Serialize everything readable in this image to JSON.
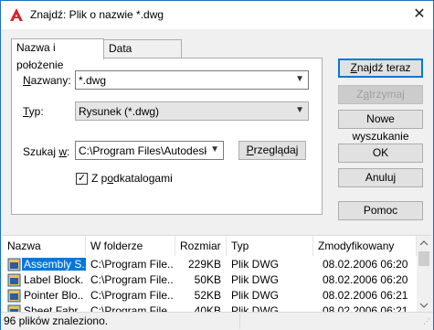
{
  "window": {
    "title": "Znajdź: Plik o nazwie *.dwg",
    "app_icon": "autocad-icon",
    "close_glyph": "✕"
  },
  "tabs": [
    {
      "label": "Nazwa i położenie",
      "active": true
    },
    {
      "label": "Data modyfikacji",
      "active": false
    }
  ],
  "form": {
    "named_label": "Nazwany:",
    "named_value": "*.dwg",
    "type_label": "Typ:",
    "type_value": "Rysunek (*.dwg)",
    "lookin_label": "Szukaj w:",
    "lookin_value": "C:\\Program Files\\Autodesk\\A",
    "browse_label": "Przeglądaj",
    "subfolders_label": "Z podkatalogami",
    "subfolders_checked": true
  },
  "buttons": {
    "find_now": "Znajdź teraz",
    "stop": "Zatrzymaj",
    "new_search": "Nowe wyszukanie",
    "ok": "OK",
    "cancel": "Anuluj",
    "help": "Pomoc"
  },
  "results": {
    "columns": [
      "Nazwa",
      "W folderze",
      "Rozmiar",
      "Typ",
      "Zmodyfikowany"
    ],
    "rows": [
      {
        "name": "Assembly S...",
        "folder": "C:\\Program File...",
        "size": "229KB",
        "type": "Plik DWG",
        "modified": "08.02.2006 06:20",
        "selected": true
      },
      {
        "name": "Label Block...",
        "folder": "C:\\Program File...",
        "size": "50KB",
        "type": "Plik DWG",
        "modified": "08.02.2006 06:20",
        "selected": false
      },
      {
        "name": "Pointer Blo...",
        "folder": "C:\\Program File...",
        "size": "52KB",
        "type": "Plik DWG",
        "modified": "08.02.2006 06:21",
        "selected": false
      },
      {
        "name": "Sheet Fabr...",
        "folder": "C:\\Program File...",
        "size": "40KB",
        "type": "Plik DWG",
        "modified": "08.02.2006 06:21",
        "selected": false
      }
    ]
  },
  "status": {
    "text": "96 plików znaleziono."
  },
  "colors": {
    "selection": "#0078d7",
    "default_button_border": "#0078d7"
  }
}
